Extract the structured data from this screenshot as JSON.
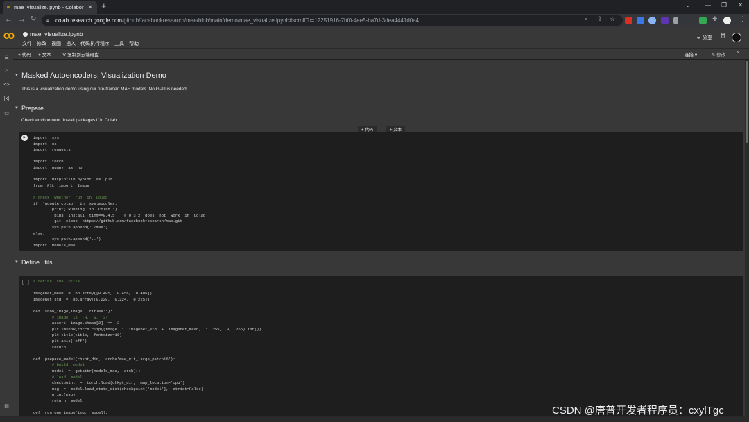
{
  "browser": {
    "tab_title": "mae_visualize.ipynb - Colabor",
    "url_host": "colab.research.google.com",
    "url_path": "/github/facebookresearch/mae/blob/main/demo/mae_visualize.ipynb#scrollTo=12251916-7bf0-4ee5-ba7d-3dea4441d0a4"
  },
  "colab": {
    "logo": "CO",
    "notebook_name": "mae_visualize.ipynb",
    "menu": [
      "文件",
      "修改",
      "视图",
      "插入",
      "代码执行程序",
      "工具",
      "帮助"
    ],
    "share_label": "分享",
    "toolbar": {
      "code": "+ 代码",
      "text": "+ 文本",
      "copy_drive": "复制到云端硬盘",
      "connect": "连接",
      "edit": "修改"
    }
  },
  "notebook": {
    "title": "Masked Autoencoders: Visualization Demo",
    "intro": "This is a visualization demo using our pre-trained MAE models. No GPU is needed.",
    "prepare_heading": "Prepare",
    "prepare_text": "Check environment. Install packages if in Colab.",
    "add_code": "+ 代码",
    "add_text": "+ 文本",
    "utils_heading": "Define utils",
    "cell2_exec": "[ ]"
  },
  "code1": [
    "import  sys",
    "import  os",
    "import  requests",
    "",
    "import  torch",
    "import  numpy  as  np",
    "",
    "import  matplotlib.pyplot  as  plt",
    "from  PIL  import  Image",
    "",
    "# check  whether  run  in  Colab",
    "if  'google.colab'  in  sys.modules:",
    "        print('Running  in  Colab.')",
    "        !pip3  install  timm==0.4.5    # 0.3.2  does  not  work  in  Colab",
    "        !git  clone  https://github.com/facebookresearch/mae.git",
    "        sys.path.append('./mae')",
    "else:",
    "        sys.path.append('..')",
    "import  models_mae"
  ],
  "code2": [
    "# define  the  utils",
    "",
    "imagenet_mean  =  np.array([0.485,  0.456,  0.406])",
    "imagenet_std  =  np.array([0.229,  0.224,  0.225])",
    "",
    "def  show_image(image,  title=''):",
    "        # image  is  [H,  W,  3]",
    "        assert  image.shape[2]  ==  3",
    "        plt.imshow(torch.clip((image  *  imagenet_std  +  imagenet_mean)  *  255,  0,  255).int())",
    "        plt.title(title,  fontsize=16)",
    "        plt.axis('off')",
    "        return",
    "",
    "def  prepare_model(chkpt_dir,  arch='mae_vit_large_patch16'):",
    "        # build  model",
    "        model  =  getattr(models_mae,  arch)()",
    "        # load  model",
    "        checkpoint  =  torch.load(chkpt_dir,  map_location='cpu')",
    "        msg  =  model.load_state_dict(checkpoint['model'],  strict=False)",
    "        print(msg)",
    "        return  model",
    "",
    "def  run_one_image(img,  model):"
  ],
  "watermark": "CSDN @唐普开发者程序员：cxylTgc"
}
